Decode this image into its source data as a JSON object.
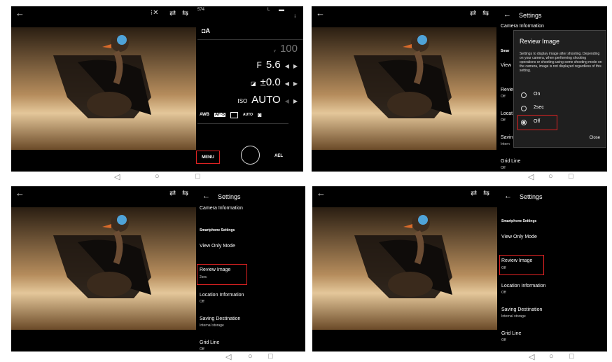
{
  "nav": {
    "back": "◁",
    "home": "○",
    "recent": "□"
  },
  "panel1": {
    "back_icon": "←",
    "top_icons": [
      "⁝✕",
      "⇄",
      "⇆"
    ],
    "status_left": "574",
    "status_right": "L",
    "mode": "A",
    "shutter_value": "100",
    "aperture_label": "F",
    "aperture_value": "5.6",
    "exposure_value": "±0.0",
    "iso_label": "ISO",
    "iso_value": "AUTO",
    "awb_label": "AWB",
    "af_label": "AF-S",
    "dro_label": "AUTO",
    "menu_label": "MENU",
    "ael_label": "AEL"
  },
  "panel2": {
    "settings_title": "Settings",
    "camera_info": "Camera Information",
    "bg_labels": [
      "Smar",
      "View",
      "Revie",
      "Off",
      "Locat",
      "Off",
      "Savin",
      "Intern"
    ],
    "grid_line": "Grid Line",
    "grid_line_value": "Off",
    "dialog_title": "Review Image",
    "dialog_text": "Settings to display image after shooting. Depending on your camera, when performing shooting operations or shooting using some shooting mode on the camera, image is not displayed regardless of this setting.",
    "options": [
      "On",
      "2sec",
      "Off"
    ],
    "selected_option": "Off",
    "close_label": "Close"
  },
  "panel3": {
    "settings_title": "Settings",
    "camera_info": "Camera Information",
    "smartphone_settings": "Smartphone Settings",
    "view_only": "View Only Mode",
    "review_image": "Review Image",
    "review_value": "2sec",
    "location": "Location Information",
    "location_value": "Off",
    "saving": "Saving Destination",
    "saving_value": "Internal storage",
    "grid_line": "Grid Line",
    "grid_line_value": "Off"
  },
  "panel4": {
    "settings_title": "Settings",
    "smartphone_settings": "Smartphone Settings",
    "view_only": "View Only Mode",
    "review_image": "Review Image",
    "review_value": "Off",
    "location": "Location Information",
    "location_value": "Off",
    "saving": "Saving Destination",
    "saving_value": "Internal storage",
    "grid_line": "Grid Line",
    "grid_line_value": "Off"
  }
}
